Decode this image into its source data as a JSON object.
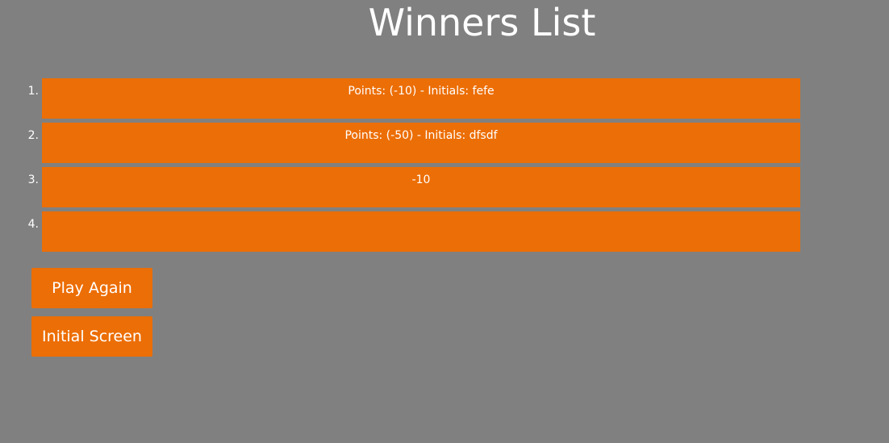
{
  "page": {
    "title": "Winners List"
  },
  "winners": [
    {
      "number": "1.",
      "text": "Points: (-10) - Initials: fefe"
    },
    {
      "number": "2.",
      "text": "Points: (-50) - Initials: dfsdf"
    },
    {
      "number": "3.",
      "text": "-10"
    },
    {
      "number": "4.",
      "text": ""
    }
  ],
  "buttons": {
    "play_again": "Play Again",
    "initial_screen": "Initial Screen"
  },
  "colors": {
    "background": "#808080",
    "accent": "#ec6e06",
    "text": "#ffffff"
  }
}
